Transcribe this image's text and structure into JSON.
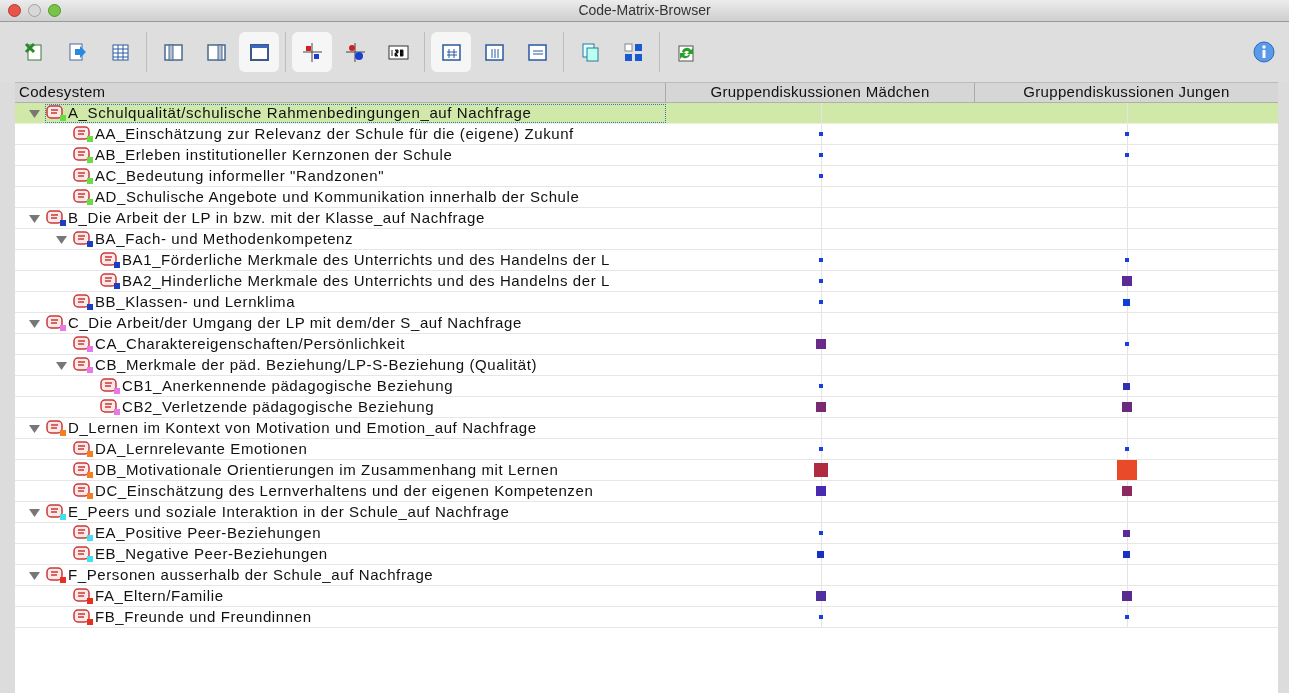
{
  "window": {
    "title": "Code-Matrix-Browser"
  },
  "toolbar": {
    "groups": [
      [
        {
          "pressed": false
        },
        {
          "pressed": false
        },
        {
          "pressed": false
        }
      ],
      [
        {
          "pressed": false
        },
        {
          "pressed": false
        },
        {
          "pressed": true
        }
      ],
      [
        {
          "pressed": true
        },
        {
          "pressed": false
        },
        {
          "pressed": false
        }
      ],
      [
        {
          "pressed": true
        },
        {
          "pressed": false
        },
        {
          "pressed": false
        }
      ],
      [
        {
          "pressed": false
        },
        {
          "pressed": false
        }
      ],
      [
        {
          "pressed": false
        }
      ]
    ]
  },
  "table": {
    "columns": [
      "Codesystem",
      "Gruppendiskussionen Mädchen",
      "Gruppendiskussionen Jungen"
    ],
    "codes": [
      {
        "label": "A_Schulqualität/schulische Rahmenbedingungen_auf Nachfrage",
        "color": "#66dd44",
        "expanded": true,
        "selected": true,
        "cells": [
          null,
          null
        ],
        "children": [
          {
            "label": "AA_Einschätzung zur Relevanz der Schule für die (eigene) Zukunf",
            "color": "#66dd44",
            "selected": false,
            "cells": [
              {
                "kind": "tiny",
                "color": "#1a3fe0"
              },
              {
                "kind": "tiny",
                "color": "#1a3fe0"
              }
            ]
          },
          {
            "label": "AB_Erleben institutioneller Kernzonen der Schule",
            "color": "#66dd44",
            "selected": false,
            "cells": [
              {
                "kind": "tiny",
                "color": "#1a3fe0"
              },
              {
                "kind": "tiny",
                "color": "#1a3fe0"
              }
            ]
          },
          {
            "label": "AC_Bedeutung informeller \"Randzonen\"",
            "color": "#66dd44",
            "selected": false,
            "cells": [
              {
                "kind": "tiny",
                "color": "#1a3fe0"
              },
              null
            ]
          },
          {
            "label": "AD_Schulische Angebote und Kommunikation innerhalb der Schule",
            "color": "#66dd44",
            "selected": false,
            "cells": [
              null,
              null
            ]
          }
        ]
      },
      {
        "label": "B_Die Arbeit der LP in bzw. mit der Klasse_auf Nachfrage",
        "color": "#1a3fbf",
        "expanded": true,
        "selected": false,
        "cells": [
          null,
          null
        ],
        "children": [
          {
            "label": "BA_Fach- und Methodenkompetenz",
            "color": "#1a3fbf",
            "expanded": true,
            "selected": false,
            "cells": [
              null,
              null
            ],
            "children": [
              {
                "label": "BA1_Förderliche Merkmale des Unterrichts und des Handelns der L",
                "color": "#1a3fbf",
                "selected": false,
                "cells": [
                  {
                    "kind": "tiny",
                    "color": "#1a3fe0"
                  },
                  {
                    "kind": "tiny",
                    "color": "#1a3fe0"
                  }
                ]
              },
              {
                "label": "BA2_Hinderliche Merkmale des Unterrichts und des Handelns der L",
                "color": "#1a3fbf",
                "selected": false,
                "cells": [
                  {
                    "kind": "tiny",
                    "color": "#1a3fe0"
                  },
                  {
                    "kind": "medium",
                    "color": "#5a2a9a"
                  }
                ]
              }
            ]
          },
          {
            "label": "BB_Klassen- und Lernklima",
            "color": "#1a3fbf",
            "selected": false,
            "cells": [
              {
                "kind": "tiny",
                "color": "#1a3fe0"
              },
              {
                "kind": "small",
                "color": "#1040d0"
              }
            ]
          }
        ]
      },
      {
        "label": "C_Die Arbeit/der Umgang der LP mit dem/der S_auf Nachfrage",
        "color": "#e878e8",
        "expanded": true,
        "selected": false,
        "cells": [
          null,
          null
        ],
        "children": [
          {
            "label": "CA_Charaktereigenschaften/Persönlichkeit",
            "color": "#e878e8",
            "selected": false,
            "cells": [
              {
                "kind": "medium",
                "color": "#6a2a8a"
              },
              {
                "kind": "tiny",
                "color": "#1a3fe0"
              }
            ]
          },
          {
            "label": "CB_Merkmale der päd. Beziehung/LP-S-Beziehung (Qualität)",
            "color": "#e878e8",
            "expanded": true,
            "selected": false,
            "cells": [
              null,
              null
            ],
            "children": [
              {
                "label": "CB1_Anerkennende pädagogische Beziehung",
                "color": "#e878e8",
                "selected": false,
                "cells": [
                  {
                    "kind": "tiny",
                    "color": "#1a3fe0"
                  },
                  {
                    "kind": "small",
                    "color": "#3030b0"
                  }
                ]
              },
              {
                "label": "CB2_Verletzende pädagogische Beziehung",
                "color": "#e878e8",
                "selected": false,
                "cells": [
                  {
                    "kind": "medium",
                    "color": "#7a2a70"
                  },
                  {
                    "kind": "medium",
                    "color": "#6a2a80"
                  }
                ]
              }
            ]
          }
        ]
      },
      {
        "label": "D_Lernen im Kontext von Motivation und Emotion_auf Nachfrage",
        "color": "#f08020",
        "expanded": true,
        "selected": false,
        "cells": [
          null,
          null
        ],
        "children": [
          {
            "label": "DA_Lernrelevante Emotionen",
            "color": "#f08020",
            "selected": false,
            "cells": [
              {
                "kind": "tiny",
                "color": "#1a3fe0"
              },
              {
                "kind": "tiny",
                "color": "#1a3fe0"
              }
            ]
          },
          {
            "label": "DB_Motivationale Orientierungen im Zusammenhang mit Lernen",
            "color": "#f08020",
            "selected": false,
            "cells": [
              {
                "kind": "large",
                "color": "#b02a40"
              },
              {
                "kind": "huge",
                "color": "#e84a2a"
              }
            ]
          },
          {
            "label": "DC_Einschätzung des Lernverhaltens und der eigenen Kompetenzen",
            "color": "#f08020",
            "selected": false,
            "cells": [
              {
                "kind": "medium",
                "color": "#4a2ab0"
              },
              {
                "kind": "medium",
                "color": "#8a2a60"
              }
            ]
          }
        ]
      },
      {
        "label": "E_Peers und soziale Interaktion in der Schule_auf Nachfrage",
        "color": "#40e0f0",
        "expanded": true,
        "selected": false,
        "cells": [
          null,
          null
        ],
        "children": [
          {
            "label": "EA_Positive Peer-Beziehungen",
            "color": "#40e0f0",
            "selected": false,
            "cells": [
              {
                "kind": "tiny",
                "color": "#1a3fe0"
              },
              {
                "kind": "small",
                "color": "#5a2a9a"
              }
            ]
          },
          {
            "label": "EB_Negative Peer-Beziehungen",
            "color": "#40e0f0",
            "selected": false,
            "cells": [
              {
                "kind": "small",
                "color": "#1a30c0"
              },
              {
                "kind": "small",
                "color": "#1a30c0"
              }
            ]
          }
        ]
      },
      {
        "label": "F_Personen ausserhalb der Schule_auf Nachfrage",
        "color": "#e83020",
        "expanded": true,
        "selected": false,
        "cells": [
          null,
          null
        ],
        "children": [
          {
            "label": "FA_Eltern/Familie",
            "color": "#e83020",
            "selected": false,
            "cells": [
              {
                "kind": "medium",
                "color": "#5030a0"
              },
              {
                "kind": "medium",
                "color": "#5a2a90"
              }
            ]
          },
          {
            "label": "FB_Freunde und Freundinnen",
            "color": "#e83020",
            "selected": false,
            "cells": [
              {
                "kind": "tiny",
                "color": "#1a3fe0"
              },
              {
                "kind": "tiny",
                "color": "#1a3fe0"
              }
            ]
          }
        ]
      }
    ]
  }
}
